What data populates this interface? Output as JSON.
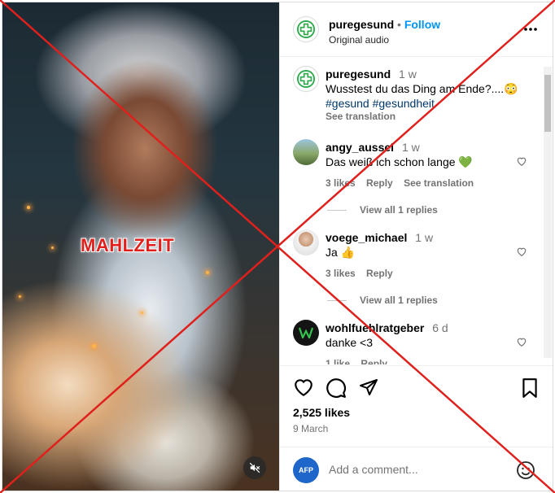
{
  "colors": {
    "accent": "#0095f6",
    "brand_green": "#2aa84a",
    "overlay_red": "#e0201c"
  },
  "media": {
    "overlay_text": "MAHLZEIT",
    "mute_icon": "speaker-muted-icon"
  },
  "header": {
    "username": "puregesund",
    "separator": "•",
    "follow_label": "Follow",
    "audio_label": "Original audio",
    "more_icon": "more-options-icon"
  },
  "caption": {
    "username": "puregesund",
    "time": "1 w",
    "text": "Wusstest du das Ding am Ende?....😳",
    "hashtags": "#gesund #gesundheit",
    "see_translation": "See translation"
  },
  "comments": [
    {
      "username": "angy_aussel",
      "time": "1 w",
      "text": "Das weiß ich schon lange 💚",
      "likes": "3 likes",
      "reply": "Reply",
      "see_translation": "See translation",
      "view_replies": "View all 1 replies"
    },
    {
      "username": "voege_michael",
      "time": "1 w",
      "text": "Ja 👍",
      "likes": "3 likes",
      "reply": "Reply",
      "view_replies": "View all 1 replies"
    },
    {
      "username": "wohlfuehlratgeber",
      "time": "6 d",
      "text": "danke <3",
      "likes": "1 like",
      "reply": "Reply"
    }
  ],
  "stats": {
    "likes": "2,525 likes",
    "date": "9 March"
  },
  "add_comment": {
    "placeholder": "Add a comment...",
    "avatar_text": "AFP"
  }
}
